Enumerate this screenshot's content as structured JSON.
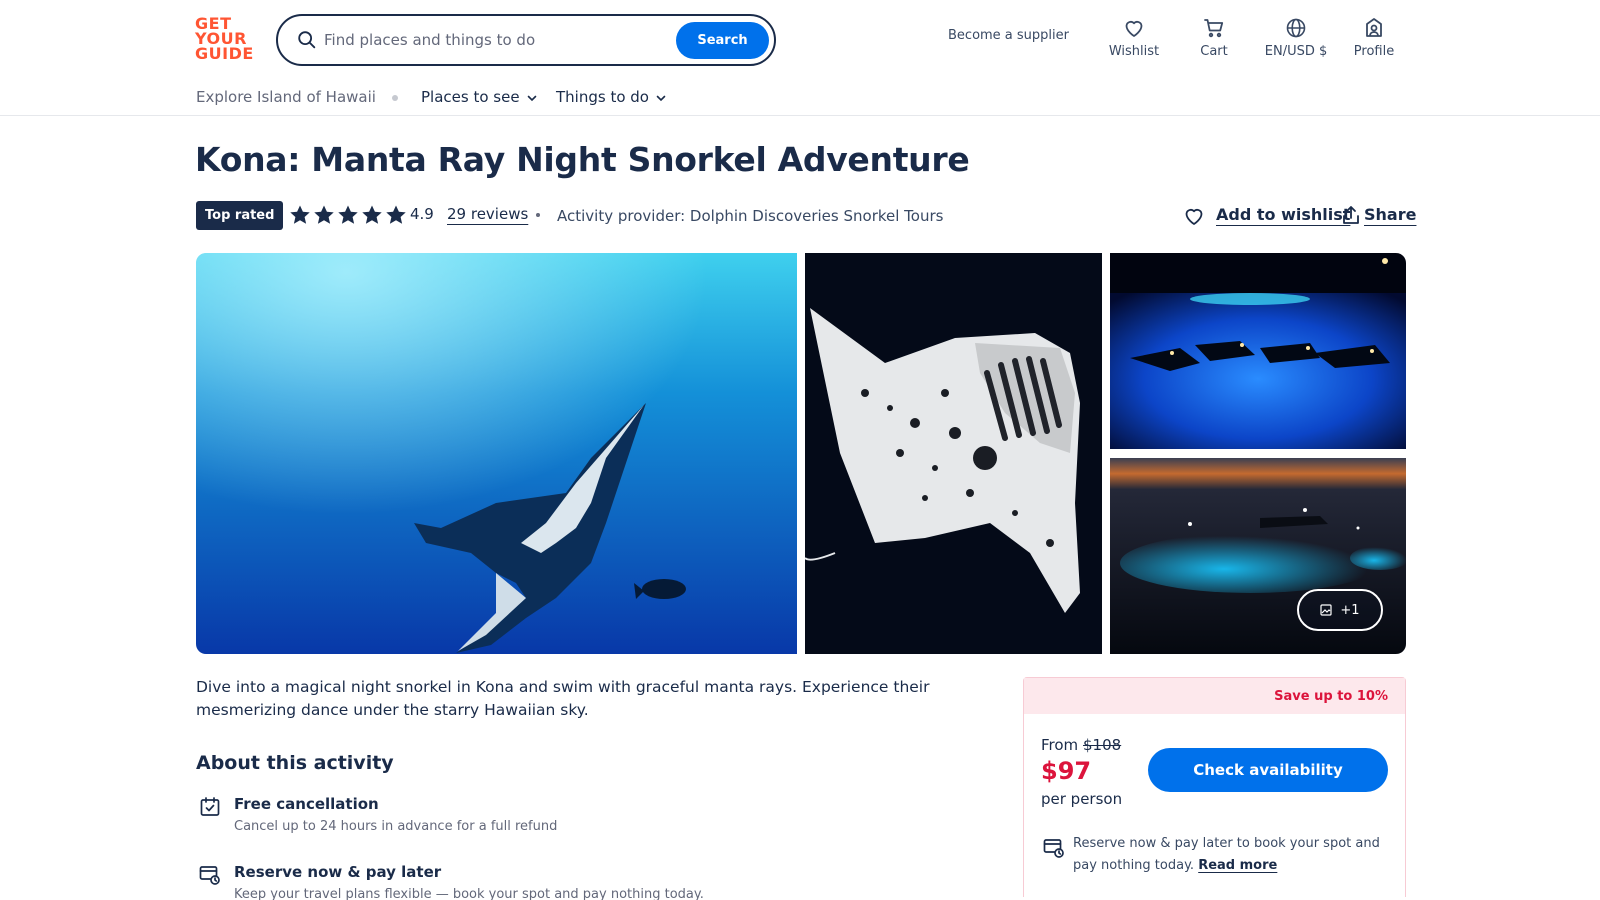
{
  "header": {
    "logo": [
      "GET",
      "YOUR",
      "GUIDE"
    ],
    "search_placeholder": "Find places and things to do",
    "search_button": "Search",
    "become_supplier": "Become a supplier",
    "wishlist": "Wishlist",
    "cart": "Cart",
    "language_currency": "EN/USD $",
    "profile": "Profile"
  },
  "subnav": {
    "explore": "Explore Island of Hawaii",
    "places": "Places to see",
    "things": "Things to do"
  },
  "activity": {
    "title": "Kona: Manta Ray Night Snorkel Adventure",
    "badge": "Top rated",
    "star_count": 5,
    "rating": "4.9",
    "reviews": "29 reviews",
    "provider": "Activity provider: Dolphin Discoveries Snorkel Tours",
    "add_to_wishlist": "Add to wishlist",
    "share": "Share"
  },
  "gallery": {
    "more_photos": "+1"
  },
  "description": "Dive into a magical night snorkel in Kona and swim with graceful manta rays. Experience their mesmerizing dance under the starry Hawaiian sky.",
  "about": {
    "heading": "About this activity",
    "features": [
      {
        "title": "Free cancellation",
        "subtitle": "Cancel up to 24 hours in advance for a full refund"
      },
      {
        "title": "Reserve now & pay later",
        "subtitle": "Keep your travel plans flexible — book your spot and pay nothing today."
      }
    ]
  },
  "booking": {
    "save_banner": "Save up to 10%",
    "from_label": "From",
    "old_price": "$108",
    "price": "$97",
    "per_person": "per person",
    "check_availability": "Check availability",
    "reserve_text": "Reserve now & pay later to book your spot and pay nothing today.",
    "read_more": "Read more"
  },
  "colors": {
    "brand_orange": "#ff5533",
    "primary_blue": "#0071eb",
    "navy": "#1a2b49",
    "sale_red": "#dc143c"
  }
}
